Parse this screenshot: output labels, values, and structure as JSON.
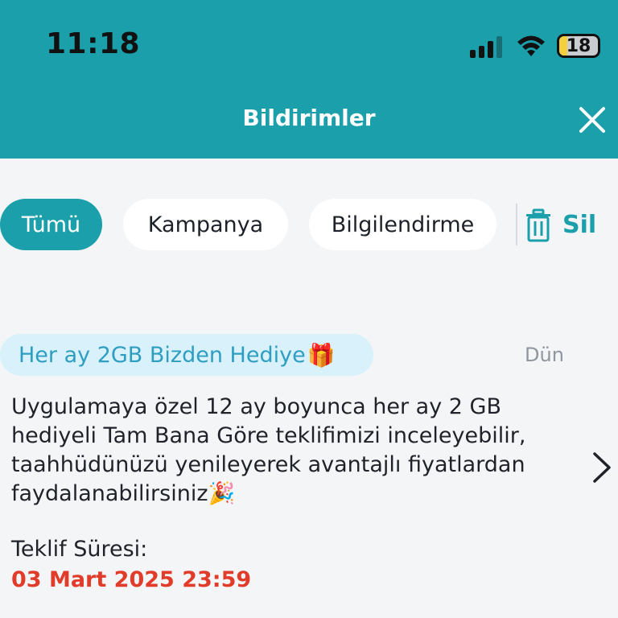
{
  "status_bar": {
    "time": "11:18",
    "battery": "18",
    "icons": [
      "signal-icon",
      "wifi-icon",
      "battery-icon"
    ]
  },
  "header": {
    "title": "Bildirimler",
    "close_icon": "close-icon"
  },
  "filters": {
    "items": [
      {
        "label": "Tümü",
        "active": true
      },
      {
        "label": "Kampanya",
        "active": false
      },
      {
        "label": "Bilgilendirme",
        "active": false
      }
    ],
    "delete_label": "Sil",
    "delete_icon": "trash-icon"
  },
  "notification": {
    "badge": "Her ay 2GB Bizden Hediye",
    "badge_emoji": "🎁",
    "date": "Dün",
    "message": "Uygulamaya özel 12 ay boyunca her ay 2 GB hediyeli Tam Bana Göre teklifimizi inceleyebilir, taahhüdünüzü yenileyerek avantajlı fiyatlardan faydalanabilirsiniz",
    "message_emoji": "🎉",
    "offer_label": "Teklif Süresi:",
    "offer_date": "03 Mart 2025 23:59"
  },
  "colors": {
    "accent": "#1ba0ab",
    "badge_bg": "#d8f1fb",
    "badge_text": "#2e9ec1",
    "deadline": "#e13b2a",
    "background": "#f4f5f7"
  }
}
